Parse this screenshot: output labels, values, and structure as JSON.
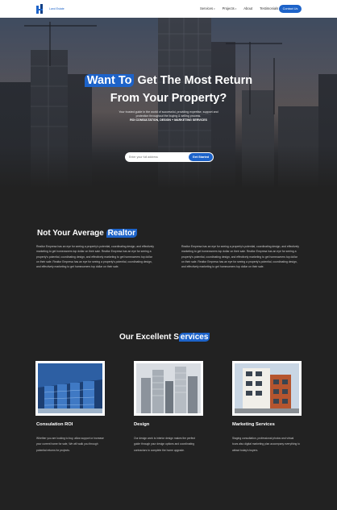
{
  "header": {
    "logo_text": "Land Estate",
    "nav": [
      {
        "label": "Services",
        "has_caret": true
      },
      {
        "label": "Projects",
        "has_caret": true
      },
      {
        "label": "About",
        "has_caret": false
      },
      {
        "label": "Testimonials",
        "has_caret": false
      }
    ],
    "contact_label": "Contact Us"
  },
  "hero": {
    "title_highlight": "Want To",
    "title_rest": " Get The Most Return",
    "title_line2": "From Your Property?",
    "subtitle": "Your trusted guide in the world of successful, providing expertise, support and protection throughout the buying & selling process.",
    "subtitle_bold": "ROI CONSULTATION, DESIGN + MARKETING SERVICES",
    "search_placeholder": "Enter your full address",
    "search_button": "Get Started"
  },
  "about": {
    "title_plain": "Not Your Average ",
    "title_highlight": "Realtor",
    "paragraph_left": "Realtor Empresa has an eye for seeing a property's potential, coordinating design, and effectively marketing to get homeowners top dollar on their sale. Realtor Empresa has an eye for seeing a property's potential, coordinating design, and effectively marketing to get homeowners top dollar on their sale. Realtor Empresa has an eye for seeing a property's potential, coordinating design, and effectively marketing to get homeowners top dollar on their sale.",
    "paragraph_right": "Realtor Empresa has an eye for seeing a property's potential, coordinating design, and effectively marketing to get homeowners top dollar on their sale. Realtor Empresa has an eye for seeing a property's potential, coordinating design, and effectively marketing to get homeowners top dollar on their sale. Realtor Empresa has an eye for seeing a property's potential, coordinating design, and effectively marketing to get homeowners top dollar on their sale."
  },
  "services": {
    "title_plain": "Our Excellent S",
    "title_highlight": "ervices",
    "items": [
      {
        "title": "Consulation ROI",
        "text": "Whether you are looking to buy, allow support or increase your current home for sale, We will walk you through potential returns for projects."
      },
      {
        "title": "Design",
        "text": "Our design work is interior design makes the perfect guide through your design options and coordinating contractors to complete the home upgrade."
      },
      {
        "title": "Marketing Services",
        "text": "Staging consultation, professional photos and virtual tours also digital marketing plan accompany everything to attract today's buyers."
      }
    ]
  },
  "colors": {
    "accent": "#1d63c9",
    "background": "#222222",
    "header": "#ffffff"
  }
}
